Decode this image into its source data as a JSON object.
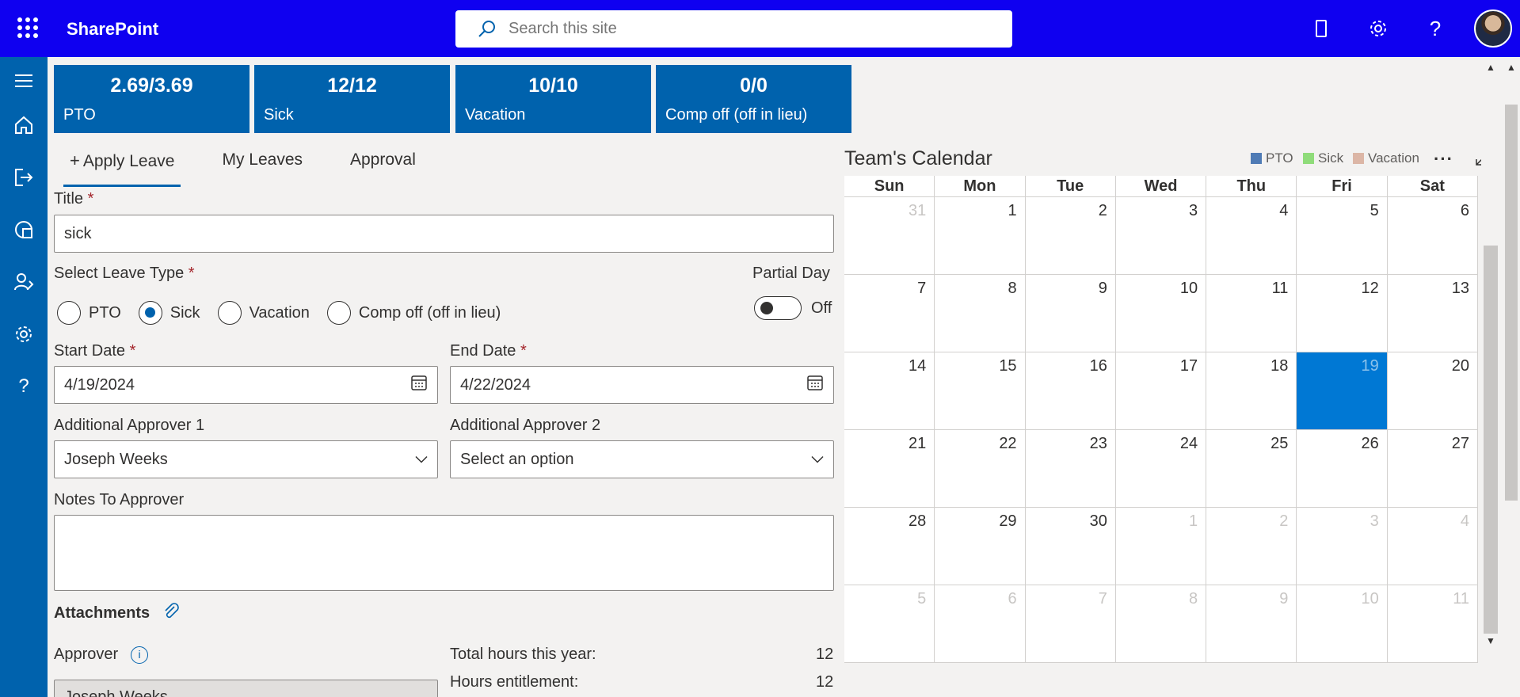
{
  "header": {
    "brand": "SharePoint",
    "search_placeholder": "Search this site"
  },
  "tiles": [
    {
      "value": "2.69/3.69",
      "label": "PTO"
    },
    {
      "value": "12/12",
      "label": "Sick"
    },
    {
      "value": "10/10",
      "label": "Vacation"
    },
    {
      "value": "0/0",
      "label": "Comp off (off in lieu)"
    }
  ],
  "tabs": {
    "apply": "Apply Leave",
    "my_leaves": "My Leaves",
    "approval": "Approval"
  },
  "form": {
    "title_label": "Title",
    "title_value": "sick",
    "leave_type_label": "Select Leave Type",
    "leave_types": [
      "PTO",
      "Sick",
      "Vacation",
      "Comp off (off in lieu)"
    ],
    "selected_leave_type": "Sick",
    "partial_day_label": "Partial Day",
    "partial_day_state": "Off",
    "start_date_label": "Start Date",
    "start_date_value": "4/19/2024",
    "end_date_label": "End Date",
    "end_date_value": "4/22/2024",
    "approver1_label": "Additional Approver 1",
    "approver1_value": "Joseph Weeks",
    "approver2_label": "Additional Approver 2",
    "approver2_value": "Select an option",
    "notes_label": "Notes To Approver",
    "notes_value": "",
    "attachments_label": "Attachments",
    "approver_label": "Approver",
    "approver_value": "Joseph Weeks",
    "required_mark": "*"
  },
  "summary": {
    "total_hours_label": "Total hours this year:",
    "total_hours_value": "12",
    "entitlement_label": "Hours entitlement:",
    "entitlement_value": "12"
  },
  "calendar": {
    "title": "Team's Calendar",
    "legend": [
      {
        "label": "PTO",
        "color": "#4f7bb5"
      },
      {
        "label": "Sick",
        "color": "#8fdc7a"
      },
      {
        "label": "Vacation",
        "color": "#dcb6a6"
      }
    ],
    "weekdays": [
      "Sun",
      "Mon",
      "Tue",
      "Wed",
      "Thu",
      "Fri",
      "Sat"
    ],
    "weeks": [
      [
        "31",
        "1",
        "2",
        "3",
        "4",
        "5",
        "6"
      ],
      [
        "7",
        "8",
        "9",
        "10",
        "11",
        "12",
        "13"
      ],
      [
        "14",
        "15",
        "16",
        "17",
        "18",
        "19",
        "20"
      ],
      [
        "21",
        "22",
        "23",
        "24",
        "25",
        "26",
        "27"
      ],
      [
        "28",
        "29",
        "30",
        "1",
        "2",
        "3",
        "4"
      ],
      [
        "5",
        "6",
        "7",
        "8",
        "9",
        "10",
        "11"
      ]
    ],
    "today": "19"
  },
  "colors": {
    "topbar": "#0f00f0",
    "brand_blue": "#0062ad",
    "today": "#0078d4"
  }
}
